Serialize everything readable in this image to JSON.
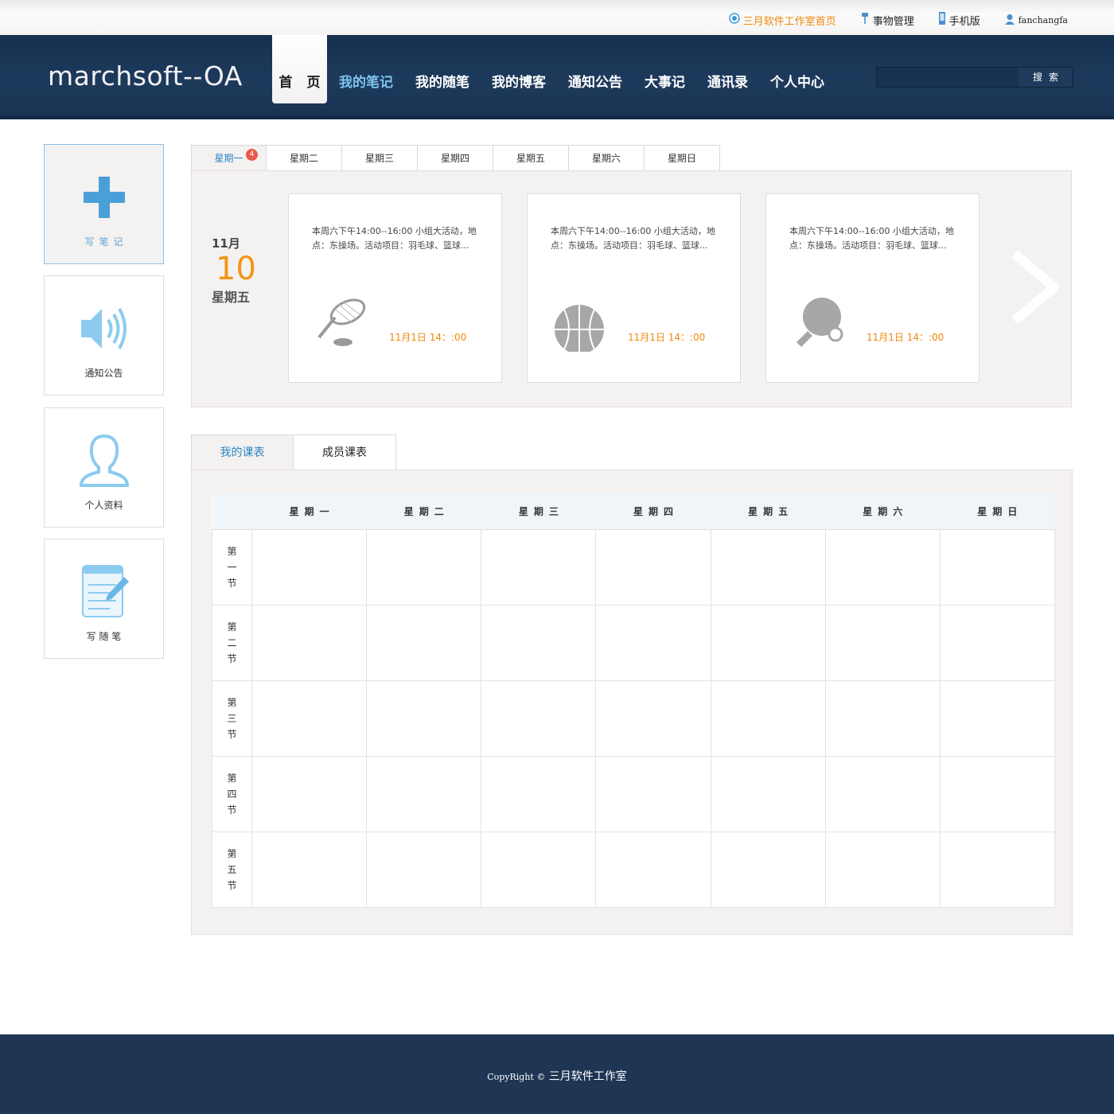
{
  "topbar": {
    "home_link": "三月软件工作室首页",
    "affairs": "事物管理",
    "mobile": "手机版",
    "username": "fanchangfa"
  },
  "header": {
    "logo": "marchsoft--OA",
    "nav": [
      "首 页",
      "我的笔记",
      "我的随笔",
      "我的博客",
      "通知公告",
      "大事记",
      "通讯录",
      "个人中心"
    ],
    "search_button": "搜索",
    "search_value": ""
  },
  "sidebar": {
    "items": [
      {
        "label": "写笔记",
        "icon": "plus-icon"
      },
      {
        "label": "通知公告",
        "icon": "speaker-icon"
      },
      {
        "label": "个人资料",
        "icon": "person-icon"
      },
      {
        "label": "写 随 笔",
        "icon": "notepad-icon"
      }
    ]
  },
  "day_tabs": {
    "tabs": [
      "星期一",
      "星期二",
      "星期三",
      "星期四",
      "星期五",
      "星期六",
      "星期日"
    ],
    "badge": "4"
  },
  "date": {
    "month": "11月",
    "day": "10",
    "weekday": "星期五"
  },
  "events": [
    {
      "text": "本周六下午14:00--16:00 小组大活动，地点：东操场。活动项目：羽毛球、篮球...",
      "time": "11月1日 14：:00",
      "icon": "tennis-racket-icon"
    },
    {
      "text": "本周六下午14:00--16:00 小组大活动，地点：东操场。活动项目：羽毛球、篮球...",
      "time": "11月1日 14：:00",
      "icon": "basketball-icon"
    },
    {
      "text": "本周六下午14:00--16:00 小组大活动，地点：东操场。活动项目：羽毛球、篮球...",
      "time": "11月1日 14：:00",
      "icon": "ping-pong-icon"
    }
  ],
  "schedule": {
    "tabs": [
      "我的课表",
      "成员课表"
    ],
    "days": [
      "星期一",
      "星期二",
      "星期三",
      "星期四",
      "星期五",
      "星期六",
      "星期日"
    ],
    "periods": [
      "第一节",
      "第二节",
      "第三节",
      "第四节",
      "第五节"
    ]
  },
  "footer": {
    "copyright_en": "CopyRight ©",
    "copyright_cn": "三月软件工作室"
  }
}
